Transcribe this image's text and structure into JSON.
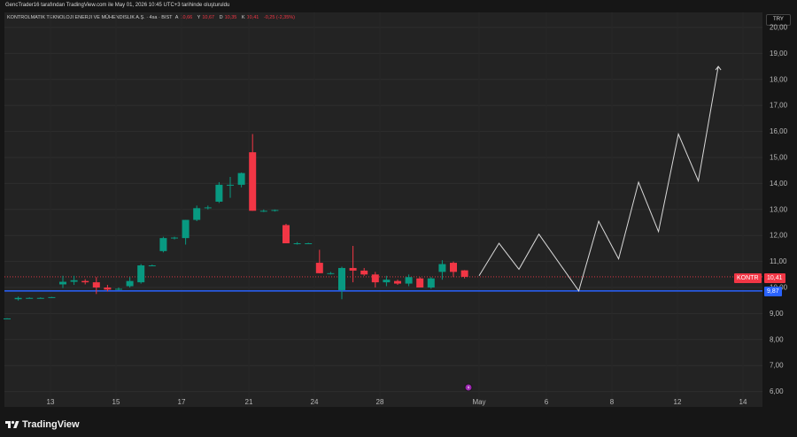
{
  "header": {
    "attribution": "GencTrader16 tarafından TradingView.com ile May 01, 2026 10:45 UTC+3 tarihinde oluşturuldu",
    "symbol_line": "KONTROLMATIK TEKNOLOJI ENERJI VE MÜHENDISLIK A.Ş. · 4sa · BIST",
    "ohlc": {
      "open_label": "A",
      "open": "10,66",
      "high_label": "Y",
      "high": "10,67",
      "low_label": "D",
      "low": "10,35",
      "close_label": "K",
      "close": "10,41",
      "change": "-0,25 (-2,35%)"
    }
  },
  "currency_badge": "TRY",
  "footer": {
    "logo_text": "TradingView"
  },
  "price_tags": {
    "symbol": "KONTR",
    "last_price": "10,41",
    "support_price": "9,87"
  },
  "colors": {
    "up": "#089981",
    "down": "#f23645",
    "support_line": "#2962ff",
    "projection": "#d9d9d9",
    "background": "#161616",
    "plot_background": "#232323"
  },
  "chart_data": {
    "type": "candlestick",
    "title": "",
    "y_axis": {
      "range": [
        5.6,
        20.25
      ],
      "ticks": [
        "6,00",
        "7,00",
        "8,00",
        "9,00",
        "10,00",
        "11,00",
        "12,00",
        "13,00",
        "14,00",
        "15,00",
        "16,00",
        "17,00",
        "18,00",
        "19,00",
        "20,00"
      ],
      "tick_values": [
        6,
        7,
        8,
        9,
        10,
        11,
        12,
        13,
        14,
        15,
        16,
        17,
        18,
        19,
        20
      ]
    },
    "x_axis": {
      "ticks": [
        "13",
        "15",
        "17",
        "21",
        "24",
        "28",
        "May",
        "6",
        "8",
        "12",
        "14"
      ]
    },
    "candles": [
      {
        "o": 8.8,
        "h": 8.82,
        "l": 8.78,
        "c": 8.81
      },
      {
        "o": 9.55,
        "h": 9.65,
        "l": 9.5,
        "c": 9.6
      },
      {
        "o": 9.6,
        "h": 9.62,
        "l": 9.58,
        "c": 9.6
      },
      {
        "o": 9.6,
        "h": 9.62,
        "l": 9.58,
        "c": 9.6
      },
      {
        "o": 9.62,
        "h": 9.64,
        "l": 9.6,
        "c": 9.63
      },
      {
        "o": 10.12,
        "h": 10.45,
        "l": 9.98,
        "c": 10.22
      },
      {
        "o": 10.22,
        "h": 10.45,
        "l": 10.1,
        "c": 10.28
      },
      {
        "o": 10.25,
        "h": 10.32,
        "l": 10.12,
        "c": 10.2
      },
      {
        "o": 10.2,
        "h": 10.4,
        "l": 9.75,
        "c": 10.0
      },
      {
        "o": 10.0,
        "h": 10.1,
        "l": 9.85,
        "c": 9.92
      },
      {
        "o": 9.92,
        "h": 10.0,
        "l": 9.9,
        "c": 9.95
      },
      {
        "o": 10.05,
        "h": 10.4,
        "l": 10.0,
        "c": 10.25
      },
      {
        "o": 10.2,
        "h": 10.9,
        "l": 10.15,
        "c": 10.85
      },
      {
        "o": 10.85,
        "h": 10.88,
        "l": 10.82,
        "c": 10.85
      },
      {
        "o": 11.4,
        "h": 11.95,
        "l": 11.35,
        "c": 11.9
      },
      {
        "o": 11.9,
        "h": 11.95,
        "l": 11.85,
        "c": 11.92
      },
      {
        "o": 11.9,
        "h": 12.6,
        "l": 11.65,
        "c": 12.6
      },
      {
        "o": 12.6,
        "h": 13.15,
        "l": 12.55,
        "c": 13.05
      },
      {
        "o": 13.05,
        "h": 13.15,
        "l": 13.0,
        "c": 13.08
      },
      {
        "o": 13.3,
        "h": 14.05,
        "l": 13.25,
        "c": 13.95
      },
      {
        "o": 13.95,
        "h": 14.25,
        "l": 13.45,
        "c": 13.95
      },
      {
        "o": 13.95,
        "h": 14.42,
        "l": 13.85,
        "c": 14.4
      },
      {
        "o": 15.2,
        "h": 15.9,
        "l": 12.95,
        "c": 12.95
      },
      {
        "o": 12.95,
        "h": 13.0,
        "l": 12.9,
        "c": 12.95
      },
      {
        "o": 12.95,
        "h": 13.0,
        "l": 12.92,
        "c": 12.98
      },
      {
        "o": 12.4,
        "h": 12.45,
        "l": 11.7,
        "c": 11.7
      },
      {
        "o": 11.7,
        "h": 11.75,
        "l": 11.65,
        "c": 11.7
      },
      {
        "o": 11.7,
        "h": 11.72,
        "l": 11.68,
        "c": 11.7
      },
      {
        "o": 10.95,
        "h": 11.45,
        "l": 10.55,
        "c": 10.55
      },
      {
        "o": 10.55,
        "h": 10.6,
        "l": 10.5,
        "c": 10.55
      },
      {
        "o": 9.9,
        "h": 10.8,
        "l": 9.55,
        "c": 10.75
      },
      {
        "o": 10.75,
        "h": 11.6,
        "l": 10.2,
        "c": 10.65
      },
      {
        "o": 10.65,
        "h": 10.75,
        "l": 10.45,
        "c": 10.5
      },
      {
        "o": 10.5,
        "h": 10.6,
        "l": 10.0,
        "c": 10.2
      },
      {
        "o": 10.2,
        "h": 10.45,
        "l": 10.05,
        "c": 10.3
      },
      {
        "o": 10.25,
        "h": 10.3,
        "l": 10.1,
        "c": 10.15
      },
      {
        "o": 10.15,
        "h": 10.5,
        "l": 10.05,
        "c": 10.4
      },
      {
        "o": 10.35,
        "h": 10.4,
        "l": 10.0,
        "c": 10.0
      },
      {
        "o": 10.0,
        "h": 10.4,
        "l": 9.95,
        "c": 10.35
      },
      {
        "o": 10.6,
        "h": 11.05,
        "l": 10.3,
        "c": 10.9
      },
      {
        "o": 10.95,
        "h": 11.0,
        "l": 10.4,
        "c": 10.6
      },
      {
        "o": 10.66,
        "h": 10.67,
        "l": 10.35,
        "c": 10.41
      }
    ],
    "support_level": 9.87,
    "last_price": 10.41,
    "projection_path": [
      {
        "t": 0,
        "price": 10.45
      },
      {
        "t": 1,
        "price": 11.7
      },
      {
        "t": 2,
        "price": 10.7
      },
      {
        "t": 3,
        "price": 12.05
      },
      {
        "t": 5,
        "price": 9.87
      },
      {
        "t": 6,
        "price": 12.55
      },
      {
        "t": 7,
        "price": 11.1
      },
      {
        "t": 8,
        "price": 14.05
      },
      {
        "t": 9,
        "price": 12.15
      },
      {
        "t": 10,
        "price": 15.9
      },
      {
        "t": 11,
        "price": 14.1
      },
      {
        "t": 12,
        "price": 18.5
      }
    ]
  }
}
